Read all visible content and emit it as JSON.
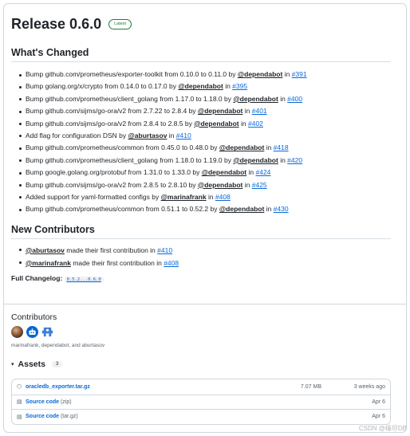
{
  "release": {
    "title": "Release 0.6.0",
    "badge": "Latest"
  },
  "whats_changed": {
    "heading": "What's Changed",
    "items": [
      {
        "text": "Bump github.com/prometheus/exporter-toolkit from 0.10.0 to 0.11.0 by ",
        "user": "@dependabot",
        "in": " in ",
        "pr": "#391"
      },
      {
        "text": "Bump golang.org/x/crypto from 0.14.0 to 0.17.0 by ",
        "user": "@dependabot",
        "in": " in ",
        "pr": "#395"
      },
      {
        "text": "Bump github.com/prometheus/client_golang from 1.17.0 to 1.18.0 by ",
        "user": "@dependabot",
        "in": " in ",
        "pr": "#400"
      },
      {
        "text": "Bump github.com/sijms/go-ora/v2 from 2.7.22 to 2.8.4 by ",
        "user": "@dependabot",
        "in": " in ",
        "pr": "#401"
      },
      {
        "text": "Bump github.com/sijms/go-ora/v2 from 2.8.4 to 2.8.5 by ",
        "user": "@dependabot",
        "in": " in ",
        "pr": "#402"
      },
      {
        "text": "Add flag for configuration DSN by ",
        "user": "@aburtasov",
        "in": " in ",
        "pr": "#410"
      },
      {
        "text": "Bump github.com/prometheus/common from 0.45.0 to 0.48.0 by ",
        "user": "@dependabot",
        "in": " in ",
        "pr": "#418"
      },
      {
        "text": "Bump github.com/prometheus/client_golang from 1.18.0 to 1.19.0 by ",
        "user": "@dependabot",
        "in": " in ",
        "pr": "#420"
      },
      {
        "text": "Bump google.golang.org/protobuf from 1.31.0 to 1.33.0 by ",
        "user": "@dependabot",
        "in": " in ",
        "pr": "#424"
      },
      {
        "text": "Bump github.com/sijms/go-ora/v2 from 2.8.5 to 2.8.10 by ",
        "user": "@dependabot",
        "in": " in ",
        "pr": "#425"
      },
      {
        "text": "Added support for yaml-formatted configs by ",
        "user": "@marinafrank",
        "in": " in ",
        "pr": "#408"
      },
      {
        "text": "Bump github.com/prometheus/common from 0.51.1 to 0.52.2 by ",
        "user": "@dependabot",
        "in": " in ",
        "pr": "#430"
      }
    ]
  },
  "new_contributors": {
    "heading": "New Contributors",
    "items": [
      {
        "user": "@aburtasov",
        "text": " made their first contribution in ",
        "pr": "#410"
      },
      {
        "user": "@marinafrank",
        "text": " made their first contribution in ",
        "pr": "#408"
      }
    ]
  },
  "changelog": {
    "label": "Full Changelog: ",
    "range": "0.5.2...0.6.0"
  },
  "contributors": {
    "heading": "Contributors",
    "names": "marinafrank, dependabot, and aburtasov"
  },
  "assets": {
    "caret": "▾",
    "title": "Assets",
    "count": "3",
    "rows": [
      {
        "icon": "⬡",
        "name": "oracledb_exporter.tar.gz",
        "suffix": "",
        "size": "7.07 MB",
        "date": "3 weeks ago"
      },
      {
        "icon": "▤",
        "name": "Source code",
        "suffix": " (zip)",
        "size": "",
        "date": "Apr 6"
      },
      {
        "icon": "▤",
        "name": "Source code",
        "suffix": " (tar.gz)",
        "size": "",
        "date": "Apr 6"
      }
    ]
  },
  "watermark": "CSDN @缘尽DB"
}
